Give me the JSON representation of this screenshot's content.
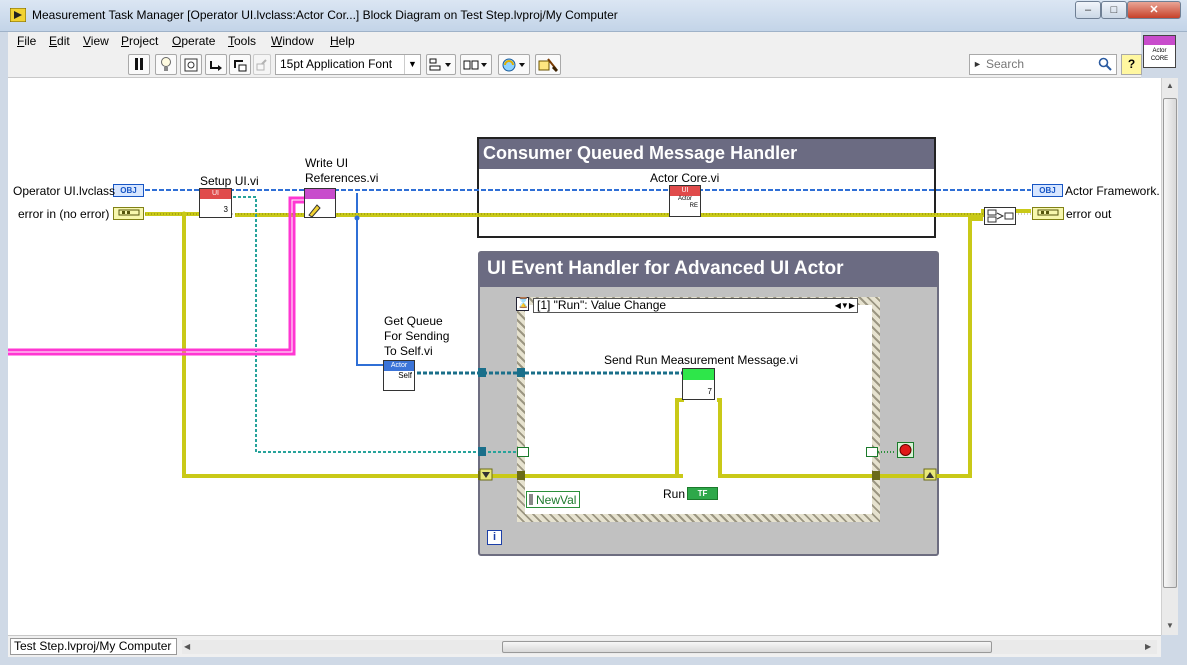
{
  "window": {
    "title": "Measurement Task Manager [Operator UI.lvclass:Actor Cor...] Block Diagram on Test Step.lvproj/My Computer",
    "minimize_label": "–",
    "maximize_label": "□",
    "close_label": "✕"
  },
  "menu": [
    {
      "u": "F",
      "rest": "ile"
    },
    {
      "u": "E",
      "rest": "dit"
    },
    {
      "u": "V",
      "rest": "iew"
    },
    {
      "u": "P",
      "rest": "roject"
    },
    {
      "u": "O",
      "rest": "perate"
    },
    {
      "u": "T",
      "rest": "ools"
    },
    {
      "u": "W",
      "rest": "indow"
    },
    {
      "u": "H",
      "rest": "elp"
    }
  ],
  "toolbar": {
    "font": "15pt Application Font",
    "search_placeholder": "Search",
    "help_label": "?"
  },
  "connector_icon": {
    "text": "Actor CORE"
  },
  "diagram": {
    "labels": {
      "operator_ui": "Operator UI.lvclass",
      "error_in": "error in (no error)",
      "setup_ui": "Setup UI.vi",
      "write_ui_1": "Write UI",
      "write_ui_2": "References.vi",
      "get_queue_1": "Get Queue",
      "get_queue_2": "For Sending",
      "get_queue_3": "To Self.vi",
      "actor_core": "Actor Core.vi",
      "actor_framework": "Actor Framework.",
      "error_out": "error out",
      "send_run": "Send Run Measurement Message.vi",
      "run": "Run",
      "newval": "NewVal"
    },
    "terminals": {
      "obj": "OBJ",
      "tf": "TF"
    },
    "nodes": {
      "setup_ui_top": "UI",
      "setup_ui_num": "3",
      "actor_core_top": "UI",
      "actor_core_txt": "Actor",
      "actor_core_re": "RE",
      "get_queue_top": "Actor",
      "get_queue_self": "Self",
      "send_run_num": "7"
    },
    "consumer_title": "Consumer Queued Message Handler",
    "ui_event_title": "UI Event Handler for Advanced UI Actor",
    "event_case": "[1] \"Run\": Value Change",
    "iteration_label": "i"
  },
  "status": {
    "project": "Test Step.lvproj/My Computer"
  },
  "colors": {
    "class_wire": "#2f6fd6",
    "error_wire": "#c9c918",
    "queue_wire": "#1a6f8a",
    "pink_wire": "#ff36d2",
    "teal_wire": "#27a39b"
  }
}
